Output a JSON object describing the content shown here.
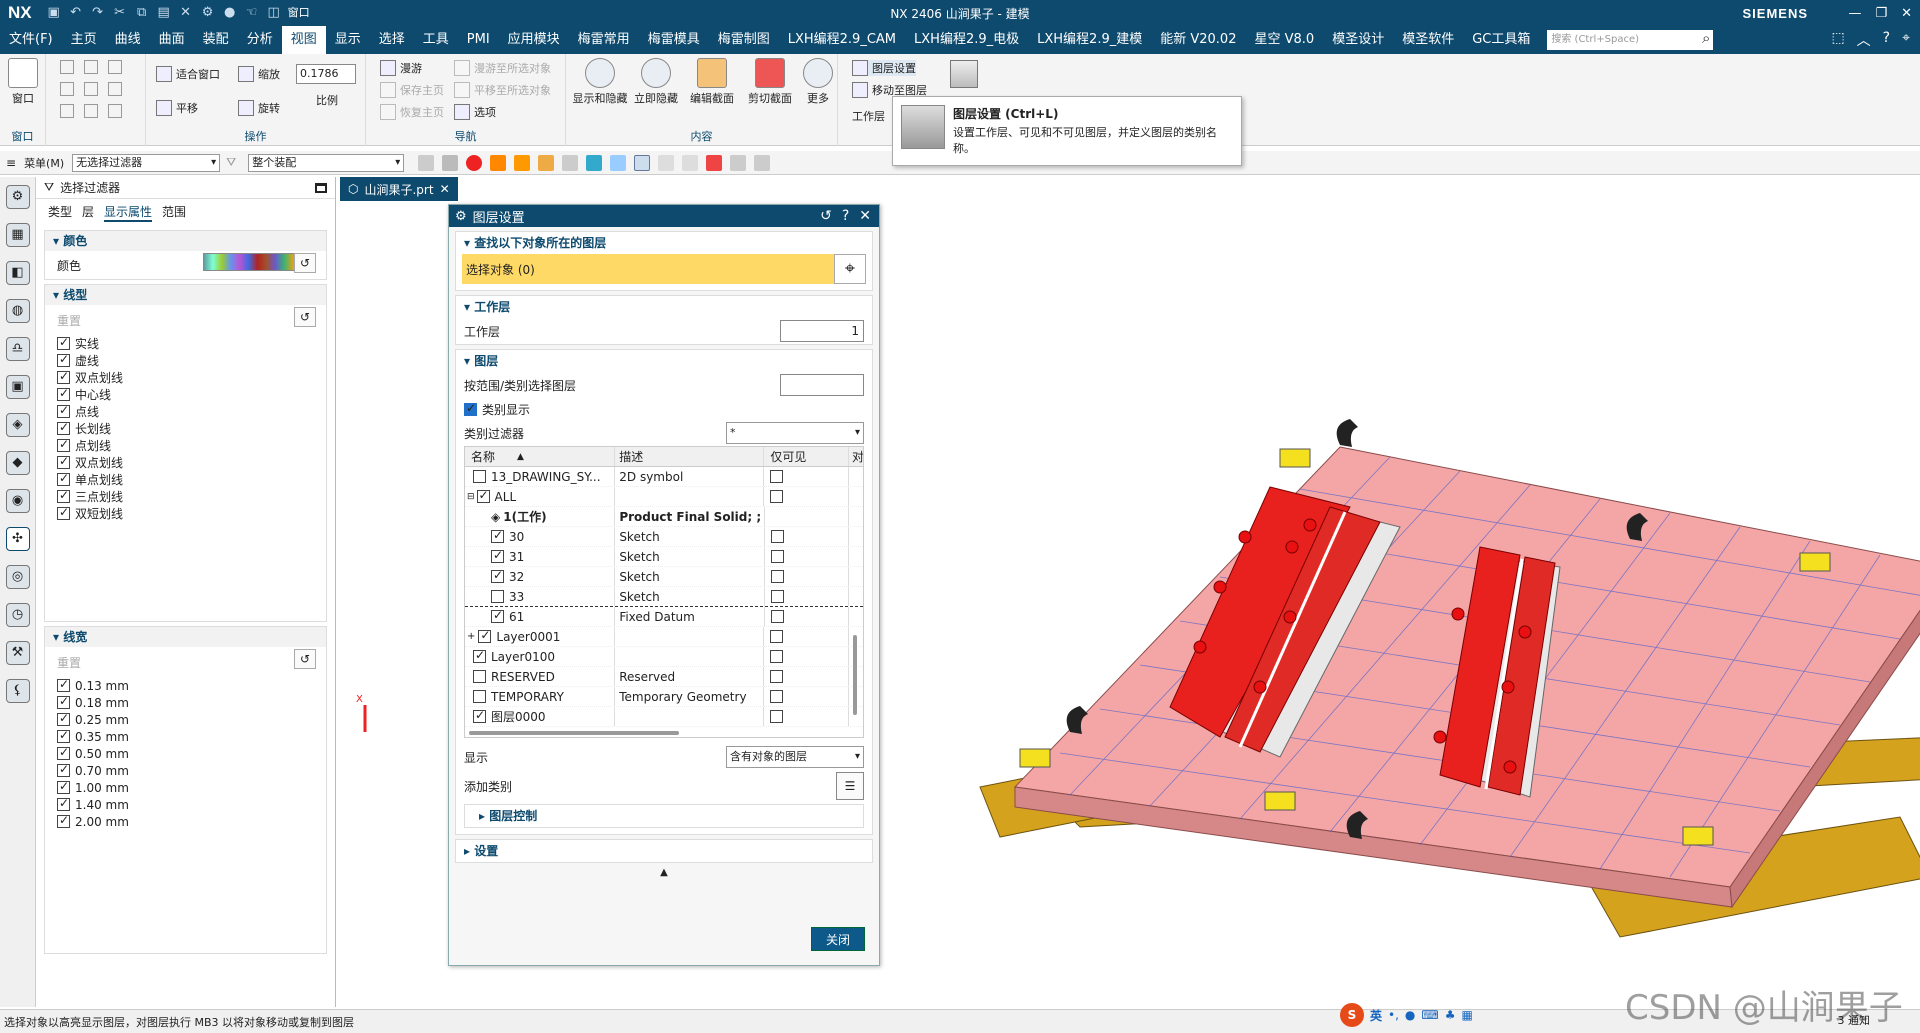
{
  "titlebar": {
    "app": "NX",
    "title": "NX 2406 山涧果子 - 建模",
    "brand": "SIEMENS",
    "window_menu": "窗口"
  },
  "menubar": {
    "items": [
      "文件(F)",
      "主页",
      "曲线",
      "曲面",
      "装配",
      "分析",
      "视图",
      "显示",
      "选择",
      "工具",
      "PMI",
      "应用模块",
      "梅雷常用",
      "梅雷模具",
      "梅雷制图",
      "LXH编程2.9_CAM",
      "LXH编程2.9_电极",
      "LXH编程2.9_建模",
      "能新 V20.02",
      "星空 V8.0",
      "模圣设计",
      "模圣软件",
      "GC工具箱"
    ],
    "active": "视图",
    "search_placeholder": "搜索 (Ctrl+Space)"
  },
  "ribbon": {
    "groups": [
      {
        "label": "窗口",
        "items": [
          "窗口"
        ]
      },
      {
        "label": "操作",
        "items": [
          "适合窗口",
          "缩放",
          "平移",
          "旋转",
          "比例"
        ],
        "scale_value": "0.1786"
      },
      {
        "label": "导航",
        "items": [
          "漫游",
          "保存主页",
          "恢复主页",
          "漫游至所选对象",
          "平移至所选对象",
          "选项"
        ]
      },
      {
        "label": "内容",
        "items": [
          "显示和隐藏",
          "立即隐藏",
          "编辑截面",
          "剪切截面",
          "更多"
        ]
      },
      {
        "label": "",
        "items": [
          "图层设置",
          "移动至图层",
          "工作层"
        ]
      }
    ]
  },
  "tooltip": {
    "title": "图层设置 (Ctrl+L)",
    "desc": "设置工作层、可见和不可见图层，并定义图层的类别名称。"
  },
  "toolbar2": {
    "menu": "菜单(M)",
    "filter": "无选择过滤器",
    "scope": "整个装配"
  },
  "filterpanel": {
    "title": "选择过滤器",
    "tabs": [
      "类型",
      "层",
      "显示属性",
      "范围"
    ],
    "tab_selected": "显示属性",
    "color_section": "颜色",
    "color_label": "颜色",
    "linetype_section": "线型",
    "reset": "重置",
    "linetypes": [
      "实线",
      "虚线",
      "双点划线",
      "中心线",
      "点线",
      "长划线",
      "点划线",
      "双点划线",
      "单点划线",
      "三点划线",
      "双短划线"
    ],
    "linewidth_section": "线宽",
    "linewidths": [
      "0.13 mm",
      "0.18 mm",
      "0.25 mm",
      "0.35 mm",
      "0.50 mm",
      "0.70 mm",
      "1.00 mm",
      "1.40 mm",
      "2.00 mm"
    ]
  },
  "doc_tab": "山涧果子.prt",
  "dialog": {
    "title": "图层设置",
    "find_section": "查找以下对象所在的图层",
    "select_obj": "选择对象 (0)",
    "work_section": "工作层",
    "work_label": "工作层",
    "work_value": "1",
    "layer_section": "图层",
    "range_label": "按范围/类别选择图层",
    "cat_display": "类别显示",
    "cat_filter_label": "类别过滤器",
    "cat_filter_value": "*",
    "table_headers": [
      "名称",
      "描述",
      "仅可见",
      "对"
    ],
    "rows": [
      {
        "name": "13_DRAWING_SY...",
        "desc": "2D symbol",
        "checked": false,
        "indent": 1,
        "bold": false
      },
      {
        "name": "ALL",
        "desc": "",
        "checked": true,
        "indent": 1,
        "bold": false,
        "expanded": true
      },
      {
        "name": "1(工作)",
        "desc": "Product Final Solid; ;",
        "checked": null,
        "indent": 2,
        "bold": true
      },
      {
        "name": "30",
        "desc": "Sketch",
        "checked": true,
        "indent": 2,
        "bold": false
      },
      {
        "name": "31",
        "desc": "Sketch",
        "checked": true,
        "indent": 2,
        "bold": false
      },
      {
        "name": "32",
        "desc": "Sketch",
        "checked": true,
        "indent": 2,
        "bold": false
      },
      {
        "name": "33",
        "desc": "Sketch",
        "checked": false,
        "indent": 2,
        "bold": false
      },
      {
        "name": "61",
        "desc": "Fixed Datum",
        "checked": true,
        "indent": 2,
        "bold": false
      },
      {
        "name": "Layer0001",
        "desc": "",
        "checked": true,
        "indent": 1,
        "bold": false
      },
      {
        "name": "Layer0100",
        "desc": "",
        "checked": true,
        "indent": 1,
        "bold": false
      },
      {
        "name": "RESERVED",
        "desc": "Reserved",
        "checked": false,
        "indent": 1,
        "bold": false
      },
      {
        "name": "TEMPORARY",
        "desc": "Temporary Geometry",
        "checked": false,
        "indent": 1,
        "bold": false
      },
      {
        "name": "图层0000",
        "desc": "",
        "checked": true,
        "indent": 1,
        "bold": false
      }
    ],
    "display_label": "显示",
    "display_value": "含有对象的图层",
    "add_cat_label": "添加类别",
    "layer_control": "图层控制",
    "settings": "设置",
    "close": "关闭"
  },
  "statusbar": "选择对象以高亮显示图层，对图层执行 MB3 以将对象移动或复制到图层",
  "ime": {
    "lang": "英"
  },
  "notify": "3 通知",
  "watermark": "CSDN @山涧果子",
  "colors": {
    "brand": "#0d4a6e",
    "accent_red": "#e8201e",
    "plate": "#f4a6a6",
    "base_wood": "#d4a21c"
  }
}
